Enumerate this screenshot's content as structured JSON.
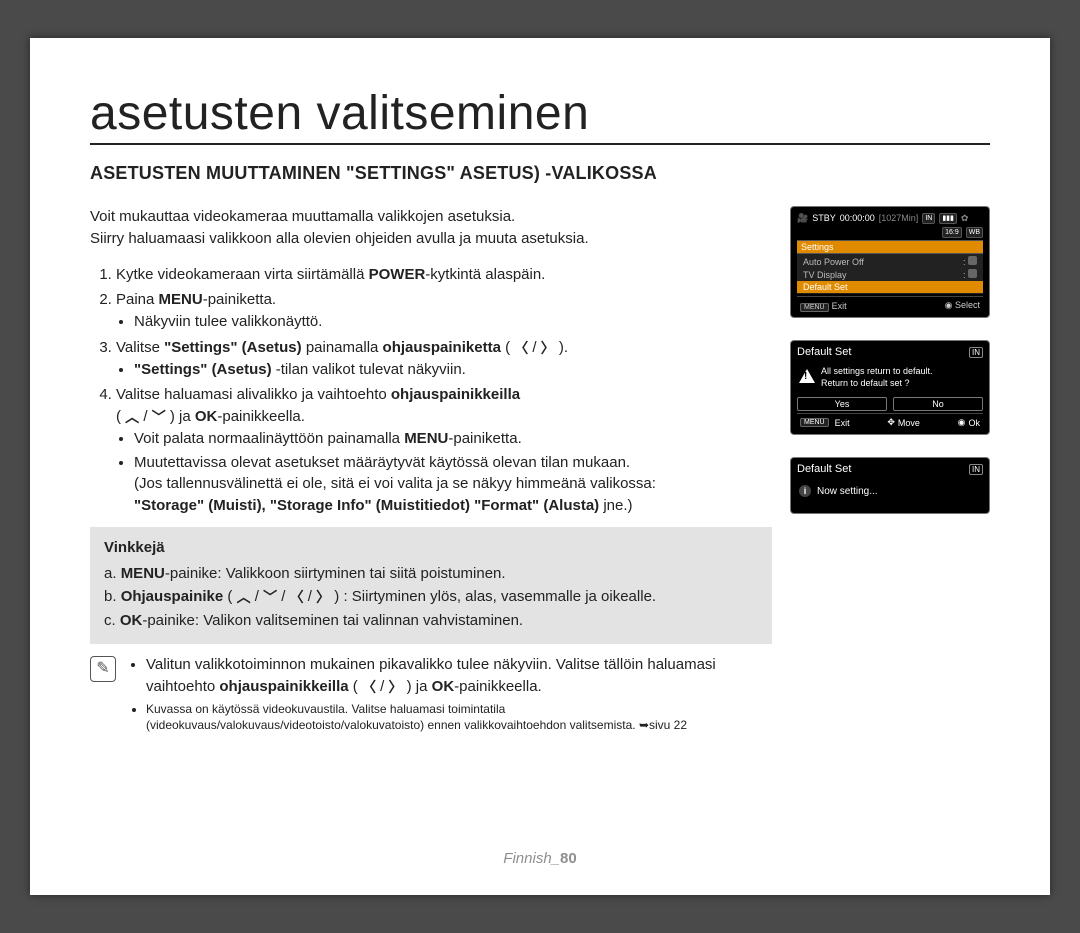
{
  "title": "asetusten valitseminen",
  "heading": "ASETUSTEN MUUTTAMINEN \"SETTINGS\" ASETUS) -VALIKOSSA",
  "intro": {
    "line1": "Voit mukauttaa videokameraa muuttamalla valikkojen asetuksia.",
    "line2": "Siirry haluamaasi valikkoon alla olevien ohjeiden avulla ja muuta asetuksia."
  },
  "steps": {
    "s1_a": "Kytke videokameraan virta siirtämällä ",
    "s1_b": "POWER",
    "s1_c": "-kytkintä alaspäin.",
    "s2_a": "Paina ",
    "s2_b": "MENU",
    "s2_c": "-painiketta.",
    "s2_sub": "Näkyviin tulee valikkonäyttö.",
    "s3_a": "Valitse ",
    "s3_b": "\"Settings\" (Asetus)",
    "s3_c": " painamalla ",
    "s3_d": "ohjauspainiketta",
    "s3_e": " ( ",
    "s3_f": " / ",
    "s3_g": " ).",
    "s3_sub_a": "\"Settings\" (Asetus)",
    "s3_sub_b": " -tilan valikot tulevat näkyviin.",
    "s4_a": "Valitse haluamasi alivalikko ja vaihtoehto ",
    "s4_b": "ohjauspainikkeilla",
    "s4_c_line": "( ",
    "s4_c_line2": " / ",
    "s4_d": " ) ja ",
    "s4_e": "OK",
    "s4_f": "-painikkeella.",
    "s4_sub1_a": "Voit palata normaalinäyttöön painamalla ",
    "s4_sub1_b": "MENU",
    "s4_sub1_c": "-painiketta.",
    "s4_sub2": "Muutettavissa olevat asetukset määräytyvät käytössä olevan tilan mukaan.",
    "s4_sub3_a": "(Jos tallennusvälinettä ei ole, sitä ei voi valita ja se näkyy himmeänä valikossa:",
    "s4_sub3_b": "\"Storage\" (Muisti), \"Storage Info\" (Muistitiedot) \"Format\" (Alusta)",
    "s4_sub3_c": " jne.)"
  },
  "tips": {
    "title": "Vinkkejä",
    "a_pre": "a.   ",
    "a_b": "MENU",
    "a_post": "-painike: Valikkoon siirtyminen tai siitä poistuminen.",
    "b_pre": "b.   ",
    "b_b": "Ohjauspainike",
    "b_mid": " ( ",
    "b_sep": " / ",
    "b_post": " )  : Siirtyminen ylös, alas, vasemmalle ja oikealle.",
    "c_pre": "c.   ",
    "c_b": "OK",
    "c_post": "-painike: Valikon valitseminen tai valinnan vahvistaminen."
  },
  "notes": {
    "n1_a": "Valitun valikkotoiminnon mukainen pikavalikko tulee näkyviin. Valitse tällöin haluamasi vaihtoehto ",
    "n1_b": "ohjauspainikkeilla",
    "n1_c": " ( ",
    "n1_d": " / ",
    "n1_e": " ) ja ",
    "n1_f": "OK",
    "n1_g": "-painikkeella.",
    "n2": "Kuvassa on käytössä videokuvaustila. Valitse haluamasi toimintatila (videokuvaus/valokuvaus/videotoisto/valokuvatoisto) ennen valikkovaihtoehdon valitsemista. ➥sivu 22"
  },
  "screen1": {
    "stby": "STBY",
    "time": "00:00:00",
    "remain": "[1027Min]",
    "in": "IN",
    "hd": "16:9",
    "settings": "Settings",
    "row1": "Auto Power Off",
    "row2": "TV Display",
    "row3": "Default Set",
    "menu": "MENU",
    "exit": "Exit",
    "select": "Select"
  },
  "screen2": {
    "title": "Default Set",
    "in": "IN",
    "msg1": "All settings return to default.",
    "msg2": "Return to default set ?",
    "yes": "Yes",
    "no": "No",
    "menu": "MENU",
    "exit": "Exit",
    "move": "Move",
    "ok": "Ok"
  },
  "screen3": {
    "title": "Default Set",
    "in": "IN",
    "msg": "Now setting..."
  },
  "pagenum": {
    "lang": "Finnish_",
    "num": "80"
  }
}
